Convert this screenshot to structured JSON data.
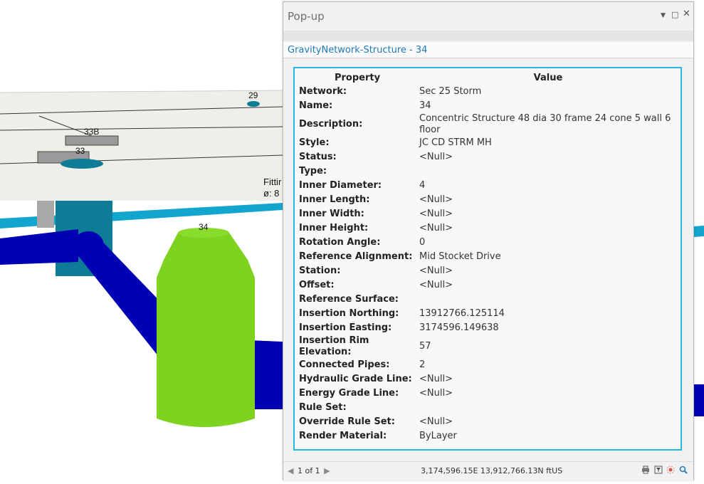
{
  "scene": {
    "labels": {
      "s29": "29",
      "s33b": "33B",
      "s33": "33",
      "s34": "34"
    },
    "fitting_line1": "Fittir",
    "fitting_line2": "ø: 8",
    "colors": {
      "green_structure": "#7ed321",
      "blue_pipe": "#0000b4",
      "teal_structure": "#0f7c97",
      "cyan_pipe": "#12a6cf",
      "surface": "#efefea"
    }
  },
  "popup": {
    "title": "Pop-up",
    "window_buttons": {
      "dropdown": "▼",
      "maximize": "□",
      "close": "✕"
    },
    "feature_link": "GravityNetwork-Structure - 34",
    "table": {
      "header_property": "Property",
      "header_value": "Value",
      "rows": [
        {
          "property": "Network:",
          "value": "Sec 25 Storm"
        },
        {
          "property": "Name:",
          "value": "34"
        },
        {
          "property": "Description:",
          "value": "Concentric Structure 48 dia 30 frame 24 cone 5 wall 6 floor"
        },
        {
          "property": "Style:",
          "value": "JC CD STRM MH"
        },
        {
          "property": "Status:",
          "value": "<Null>"
        },
        {
          "property": "Type:",
          "value": ""
        },
        {
          "property": "Inner Diameter:",
          "value": "4"
        },
        {
          "property": "Inner Length:",
          "value": "<Null>"
        },
        {
          "property": "Inner Width:",
          "value": "<Null>"
        },
        {
          "property": "Inner Height:",
          "value": "<Null>"
        },
        {
          "property": "Rotation Angle:",
          "value": "0"
        },
        {
          "property": "Reference Alignment:",
          "value": "Mid Stocket Drive"
        },
        {
          "property": "Station:",
          "value": "<Null>"
        },
        {
          "property": "Offset:",
          "value": "<Null>"
        },
        {
          "property": "Reference Surface:",
          "value": ""
        },
        {
          "property": "Insertion Northing:",
          "value": "13912766.125114"
        },
        {
          "property": "Insertion Easting:",
          "value": "3174596.149638"
        },
        {
          "property": "Insertion Rim Elevation:",
          "value": "57"
        },
        {
          "property": "Connected Pipes:",
          "value": "2"
        },
        {
          "property": "Hydraulic Grade Line:",
          "value": "<Null>"
        },
        {
          "property": "Energy Grade Line:",
          "value": "<Null>"
        },
        {
          "property": "Rule Set:",
          "value": ""
        },
        {
          "property": "Override Rule Set:",
          "value": "<Null>"
        },
        {
          "property": "Render Material:",
          "value": "ByLayer"
        }
      ]
    },
    "footer": {
      "prev": "◀",
      "count": "1 of 1",
      "next": "▶",
      "coordinates": "3,174,596.15E 13,912,766.13N ftUS",
      "icons": [
        "print-icon",
        "filter-icon",
        "flash-icon",
        "zoom-icon"
      ]
    }
  }
}
